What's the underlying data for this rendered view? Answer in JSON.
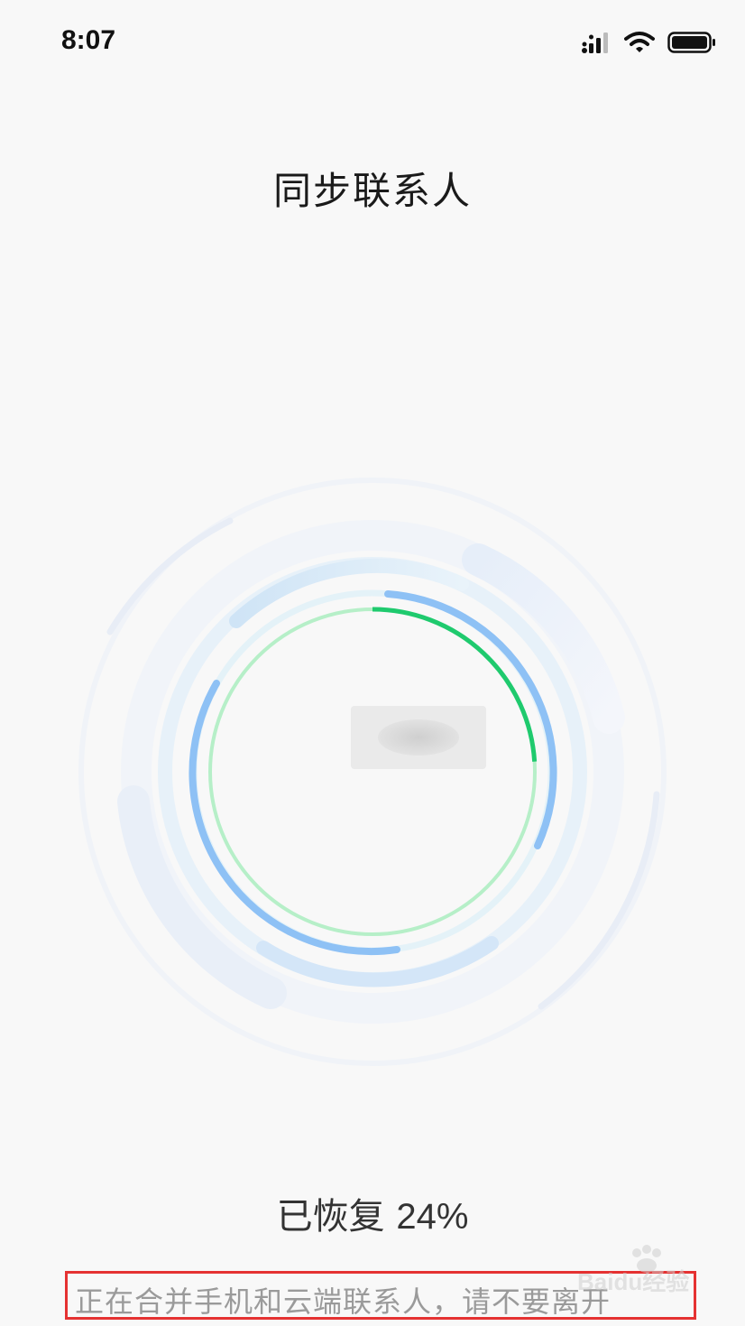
{
  "status_bar": {
    "time": "8:07",
    "icons": [
      "signal-icon",
      "wifi-icon",
      "battery-icon"
    ]
  },
  "title": "同步联系人",
  "progress": {
    "prefix": "已恢复",
    "percent_text": "24%",
    "value": 0.24
  },
  "hint": "正在合并手机和云端联系人，请不要离开",
  "watermark": {
    "text": "Baidu经验",
    "icon": "paw-icon"
  },
  "colors": {
    "progress_green": "#1fca6e",
    "track_green": "#b6efc8",
    "ring_blue": "#8ec1f5",
    "hint_border": "#e53232",
    "background": "#f8f8f8"
  }
}
